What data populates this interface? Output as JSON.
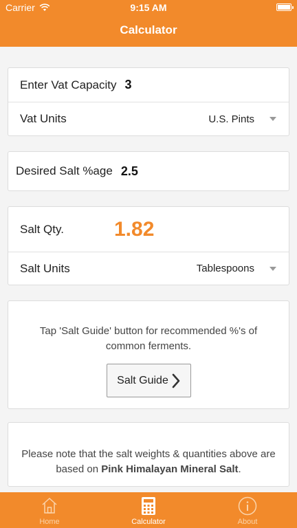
{
  "status_bar": {
    "carrier": "Carrier",
    "time": "9:15 AM"
  },
  "header": {
    "title": "Calculator",
    "accent_color": "#f28a2b"
  },
  "vat_card": {
    "capacity_label": "Enter Vat Capacity",
    "capacity_value": "3",
    "units_label": "Vat Units",
    "units_value": "U.S. Pints"
  },
  "salt_percent_card": {
    "label": "Desired Salt %age",
    "value": "2.5"
  },
  "result_card": {
    "qty_label": "Salt Qty.",
    "qty_value": "1.82",
    "units_label": "Salt Units",
    "units_value": "Tablespoons"
  },
  "guide_card": {
    "text": "Tap 'Salt Guide' button for recommended %'s of common ferments.",
    "button_label": "Salt Guide"
  },
  "note_card": {
    "text_prefix": "Please note that the salt weights & quantities above are based on ",
    "text_bold": "Pink Himalayan Mineral Salt",
    "text_suffix": "."
  },
  "tabbar": {
    "tabs": [
      {
        "label": "Home",
        "icon": "home-icon",
        "active": false
      },
      {
        "label": "Calculator",
        "icon": "calculator-icon",
        "active": true
      },
      {
        "label": "About",
        "icon": "info-icon",
        "active": false
      }
    ]
  }
}
